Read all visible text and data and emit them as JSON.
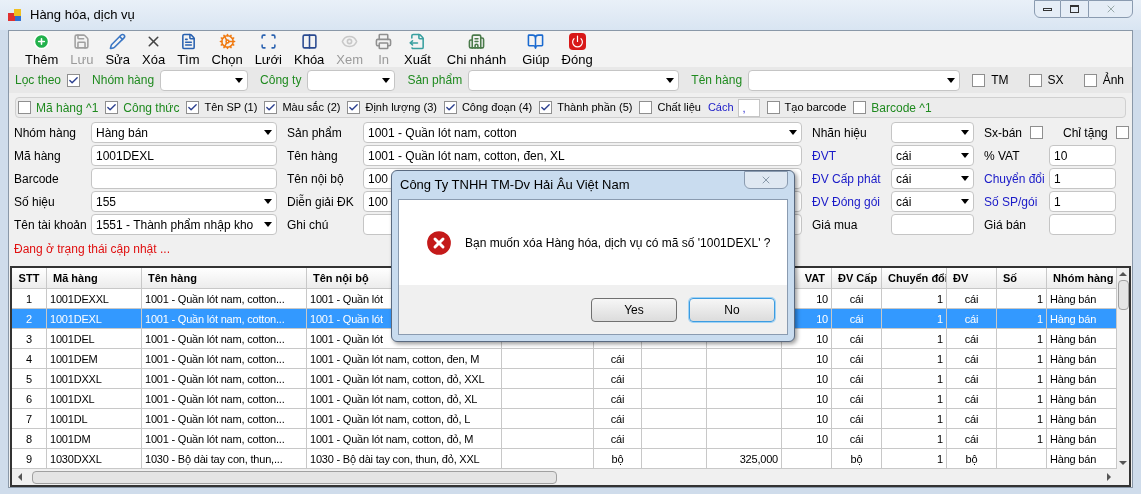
{
  "window": {
    "title": "Hàng hóa, dịch vụ"
  },
  "toolbar": [
    {
      "label": "Thêm",
      "disabled": false
    },
    {
      "label": "Lưu",
      "disabled": true
    },
    {
      "label": "Sửa",
      "disabled": false
    },
    {
      "label": "Xóa",
      "disabled": false
    },
    {
      "label": "Tìm",
      "disabled": false
    },
    {
      "label": "Chọn",
      "disabled": false
    },
    {
      "label": "Lưới",
      "disabled": false
    },
    {
      "label": "Khóa",
      "disabled": false
    },
    {
      "label": "Xem",
      "disabled": true
    },
    {
      "label": "In",
      "disabled": true
    },
    {
      "label": "Xuất",
      "disabled": false
    },
    {
      "label": "Chi nhánh",
      "disabled": false
    },
    {
      "label": "Giúp",
      "disabled": false
    },
    {
      "label": "Đóng",
      "disabled": false
    }
  ],
  "filter_bar": {
    "label": "Lọc theo",
    "checked": true,
    "filters": [
      {
        "label": "Nhóm hàng"
      },
      {
        "label": "Công ty"
      },
      {
        "label": "Sản phẩm"
      },
      {
        "label": "Tên hàng"
      }
    ],
    "toggles": [
      {
        "label": "TM",
        "checked": false
      },
      {
        "label": "SX",
        "checked": false
      },
      {
        "label": "Ảnh",
        "checked": false
      }
    ]
  },
  "options_bar": [
    {
      "kind": "check",
      "label": "Mã hàng ^1",
      "checked": false,
      "color": "#1f8a1f"
    },
    {
      "kind": "check",
      "label": "Công thức",
      "checked": true,
      "color": "#1f8a1f"
    },
    {
      "kind": "check",
      "label": "Tên SP (1)",
      "checked": true
    },
    {
      "kind": "check",
      "label": "Màu sắc (2)",
      "checked": true
    },
    {
      "kind": "check",
      "label": "Định lượng (3)",
      "checked": true
    },
    {
      "kind": "check",
      "label": "Công đoạn (4)",
      "checked": true
    },
    {
      "kind": "check",
      "label": "Thành phần (5)",
      "checked": true
    },
    {
      "kind": "check",
      "label": "Chất liệu",
      "checked": false
    },
    {
      "kind": "field",
      "label": "Cách",
      "value": ",",
      "color": "#1a1ac8"
    },
    {
      "kind": "check",
      "label": "Tạo barcode",
      "checked": false
    },
    {
      "kind": "check",
      "label": "Barcode ^1",
      "checked": false,
      "color": "#1f8a1f"
    }
  ],
  "form_rows": [
    [
      {
        "kind": "combo",
        "label": "Nhóm hàng",
        "value": "Hàng bán"
      },
      {
        "kind": "combo",
        "label": "Sản phẩm",
        "value": "1001 - Quần lót nam, cotton"
      },
      {
        "kind": "combo",
        "label": "Nhãn hiệu"
      },
      {
        "kind": "checks",
        "checks": [
          {
            "label": "Sx-bán",
            "checked": false
          },
          {
            "label": "Chỉ tặng",
            "checked": false
          }
        ]
      }
    ],
    [
      {
        "kind": "text",
        "label": "Mã hàng",
        "value": "1001DEXL"
      },
      {
        "kind": "text",
        "label": "Tên hàng",
        "value": "1001 - Quần lót nam, cotton, đen, XL"
      },
      {
        "kind": "combo",
        "label": "ĐVT",
        "value": "cái",
        "color": "#1a1ac8"
      },
      {
        "kind": "text",
        "label": "% VAT",
        "value": "10"
      }
    ],
    [
      {
        "kind": "text",
        "label": "Barcode"
      },
      {
        "kind": "text",
        "label": "Tên nội bộ",
        "value": "100"
      },
      {
        "kind": "combo",
        "label": "ĐV Cấp phát",
        "value": "cái",
        "color": "#1a1ac8"
      },
      {
        "kind": "text",
        "label": "Chuyển đổi",
        "value": "1",
        "color": "#1a1ac8"
      }
    ],
    [
      {
        "kind": "combo",
        "label": "Số hiệu",
        "value": "155"
      },
      {
        "kind": "text",
        "label": "Diễn giải ĐK",
        "value": "100"
      },
      {
        "kind": "combo",
        "label": "ĐV Đóng gói",
        "value": "cái",
        "color": "#1a1ac8"
      },
      {
        "kind": "text",
        "label": "Số SP/gói",
        "value": "1",
        "color": "#1a1ac8"
      }
    ],
    [
      {
        "kind": "combo",
        "label": "Tên tài khoản",
        "value": "1551 - Thành phẩm nhập kho"
      },
      {
        "kind": "text",
        "label": "Ghi chú"
      },
      {
        "kind": "text",
        "label": "Giá mua"
      },
      {
        "kind": "text",
        "label": "Giá bán"
      }
    ]
  ],
  "status": "Đang ở trạng thái cập nhật ...",
  "table": {
    "columns": [
      "STT",
      "Mã hàng",
      "Tên hàng",
      "Tên nội bộ",
      null,
      null,
      null,
      null,
      "VAT",
      "ĐV Cấp",
      "Chuyển đổi",
      "ĐV",
      "Số",
      "Nhóm hàng"
    ],
    "rows": [
      {
        "selected": false,
        "cells": [
          "1",
          "1001DEXXL",
          "1001 - Quần lót nam, cotton...",
          "1001 - Quần lót",
          null,
          null,
          null,
          null,
          "10",
          "cái",
          "1",
          "cái",
          "1",
          "Hàng bán"
        ]
      },
      {
        "selected": true,
        "cells": [
          "2",
          "1001DEXL",
          "1001 - Quần lót nam, cotton...",
          "1001 - Quần lót",
          null,
          null,
          null,
          null,
          "10",
          "cái",
          "1",
          "cái",
          "1",
          "Hàng bán"
        ]
      },
      {
        "selected": false,
        "cells": [
          "3",
          "1001DEL",
          "1001 - Quần lót nam, cotton...",
          "1001 - Quần lót",
          null,
          null,
          null,
          null,
          "10",
          "cái",
          "1",
          "cái",
          "1",
          "Hàng bán"
        ]
      },
      {
        "selected": false,
        "cells": [
          "4",
          "1001DEM",
          "1001 - Quần lót nam, cotton...",
          "1001 - Quần lót nam, cotton, đen, M",
          null,
          "cái",
          null,
          null,
          "10",
          "cái",
          "1",
          "cái",
          "1",
          "Hàng bán"
        ]
      },
      {
        "selected": false,
        "cells": [
          "5",
          "1001DXXL",
          "1001 - Quần lót nam, cotton...",
          "1001 - Quần lót nam, cotton, đỏ, XXL",
          null,
          "cái",
          null,
          null,
          "10",
          "cái",
          "1",
          "cái",
          "1",
          "Hàng bán"
        ]
      },
      {
        "selected": false,
        "cells": [
          "6",
          "1001DXL",
          "1001 - Quần lót nam, cotton...",
          "1001 - Quần lót nam, cotton, đỏ, XL",
          null,
          "cái",
          null,
          null,
          "10",
          "cái",
          "1",
          "cái",
          "1",
          "Hàng bán"
        ]
      },
      {
        "selected": false,
        "cells": [
          "7",
          "1001DL",
          "1001 - Quần lót nam, cotton...",
          "1001 - Quần lót nam, cotton, đỏ, L",
          null,
          "cái",
          null,
          null,
          "10",
          "cái",
          "1",
          "cái",
          "1",
          "Hàng bán"
        ]
      },
      {
        "selected": false,
        "cells": [
          "8",
          "1001DM",
          "1001 - Quần lót nam, cotton...",
          "1001 - Quần lót nam, cotton, đỏ, M",
          null,
          "cái",
          null,
          null,
          "10",
          "cái",
          "1",
          "cái",
          "1",
          "Hàng bán"
        ]
      },
      {
        "selected": false,
        "cells": [
          "9",
          "1030DXXL",
          "1030 - Bộ dài tay con, thun,...",
          "1030 - Bộ dài tay con, thun, đỏ, XXL",
          null,
          "bộ",
          null,
          "325,000",
          null,
          "bộ",
          "1",
          "bộ",
          null,
          "Hàng bán"
        ]
      }
    ]
  },
  "dialog": {
    "title": "Công Ty TNHH TM-Dv Hải Âu Việt Nam",
    "message": "Bạn muốn xóa Hàng hóa, dịch vụ có mã số '1001DEXL' ?",
    "buttons": [
      {
        "label": "Yes",
        "default": false
      },
      {
        "label": "No",
        "default": true
      }
    ]
  }
}
